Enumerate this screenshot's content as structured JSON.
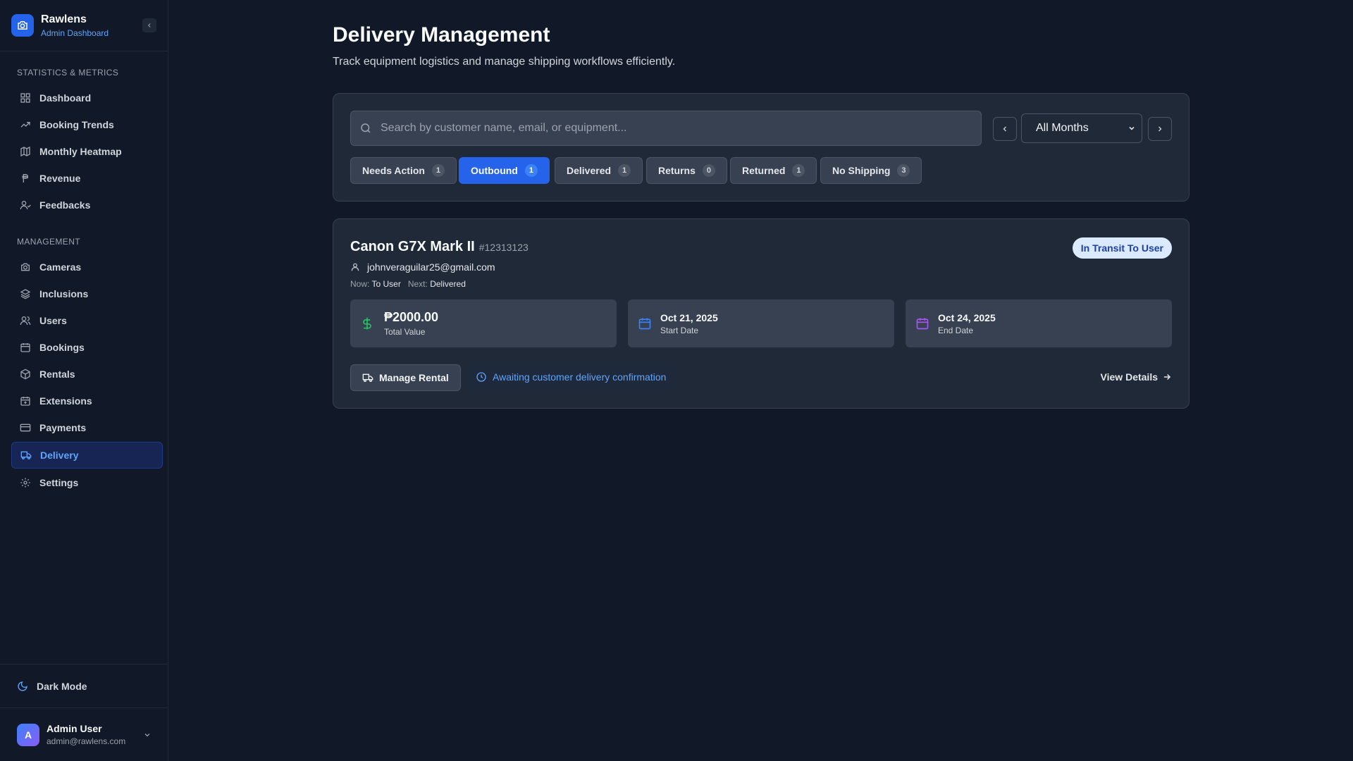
{
  "brand": {
    "name": "Rawlens",
    "subtitle": "Admin Dashboard"
  },
  "sidebar": {
    "sections": [
      {
        "title": "Statistics & Metrics"
      },
      {
        "title": "Management"
      }
    ],
    "items": [
      {
        "label": "Dashboard",
        "icon": "dashboard-icon"
      },
      {
        "label": "Booking Trends",
        "icon": "trending-up-icon"
      },
      {
        "label": "Monthly Heatmap",
        "icon": "map-icon"
      },
      {
        "label": "Revenue",
        "icon": "peso-icon"
      },
      {
        "label": "Feedbacks",
        "icon": "user-feedback-icon"
      },
      {
        "label": "Cameras",
        "icon": "camera-icon"
      },
      {
        "label": "Inclusions",
        "icon": "layers-icon"
      },
      {
        "label": "Users",
        "icon": "users-icon"
      },
      {
        "label": "Bookings",
        "icon": "calendar-icon"
      },
      {
        "label": "Rentals",
        "icon": "package-icon"
      },
      {
        "label": "Extensions",
        "icon": "calendar-plus-icon"
      },
      {
        "label": "Payments",
        "icon": "credit-card-icon"
      },
      {
        "label": "Delivery",
        "icon": "truck-icon",
        "active": true
      },
      {
        "label": "Settings",
        "icon": "gear-icon"
      }
    ],
    "dark_mode_label": "Dark Mode",
    "user": {
      "initial": "A",
      "name": "Admin User",
      "email": "admin@rawlens.com"
    }
  },
  "header": {
    "title": "Delivery Management",
    "subtitle": "Track equipment logistics and manage shipping workflows efficiently."
  },
  "filters": {
    "search_placeholder": "Search by customer name, email, or equipment...",
    "month_selected": "All Months",
    "tabs": [
      {
        "label": "Needs Action",
        "count": "1"
      },
      {
        "label": "Outbound",
        "count": "1",
        "active": true
      },
      {
        "label": "Delivered",
        "count": "1"
      },
      {
        "label": "Returns",
        "count": "0"
      },
      {
        "label": "Returned",
        "count": "1"
      },
      {
        "label": "No Shipping",
        "count": "3"
      }
    ]
  },
  "rental": {
    "title": "Canon G7X Mark II",
    "id": "#12313123",
    "status": "In Transit To User",
    "email": "johnveraguilar25@gmail.com",
    "now_label": "Now:",
    "now_value": "To User",
    "next_label": "Next:",
    "next_value": "Delivered",
    "total_value": "₱2000.00",
    "total_label": "Total Value",
    "start_date": "Oct 21, 2025",
    "start_label": "Start Date",
    "end_date": "Oct 24, 2025",
    "end_label": "End Date",
    "manage_label": "Manage Rental",
    "await_text": "Awaiting customer delivery confirmation",
    "view_details": "View Details"
  },
  "colors": {
    "background": "#111827",
    "card": "#1f2937",
    "accent": "#2563eb",
    "accent_text": "#60a5fa",
    "money_green": "#22c55e",
    "end_date_purple": "#a855f7"
  }
}
